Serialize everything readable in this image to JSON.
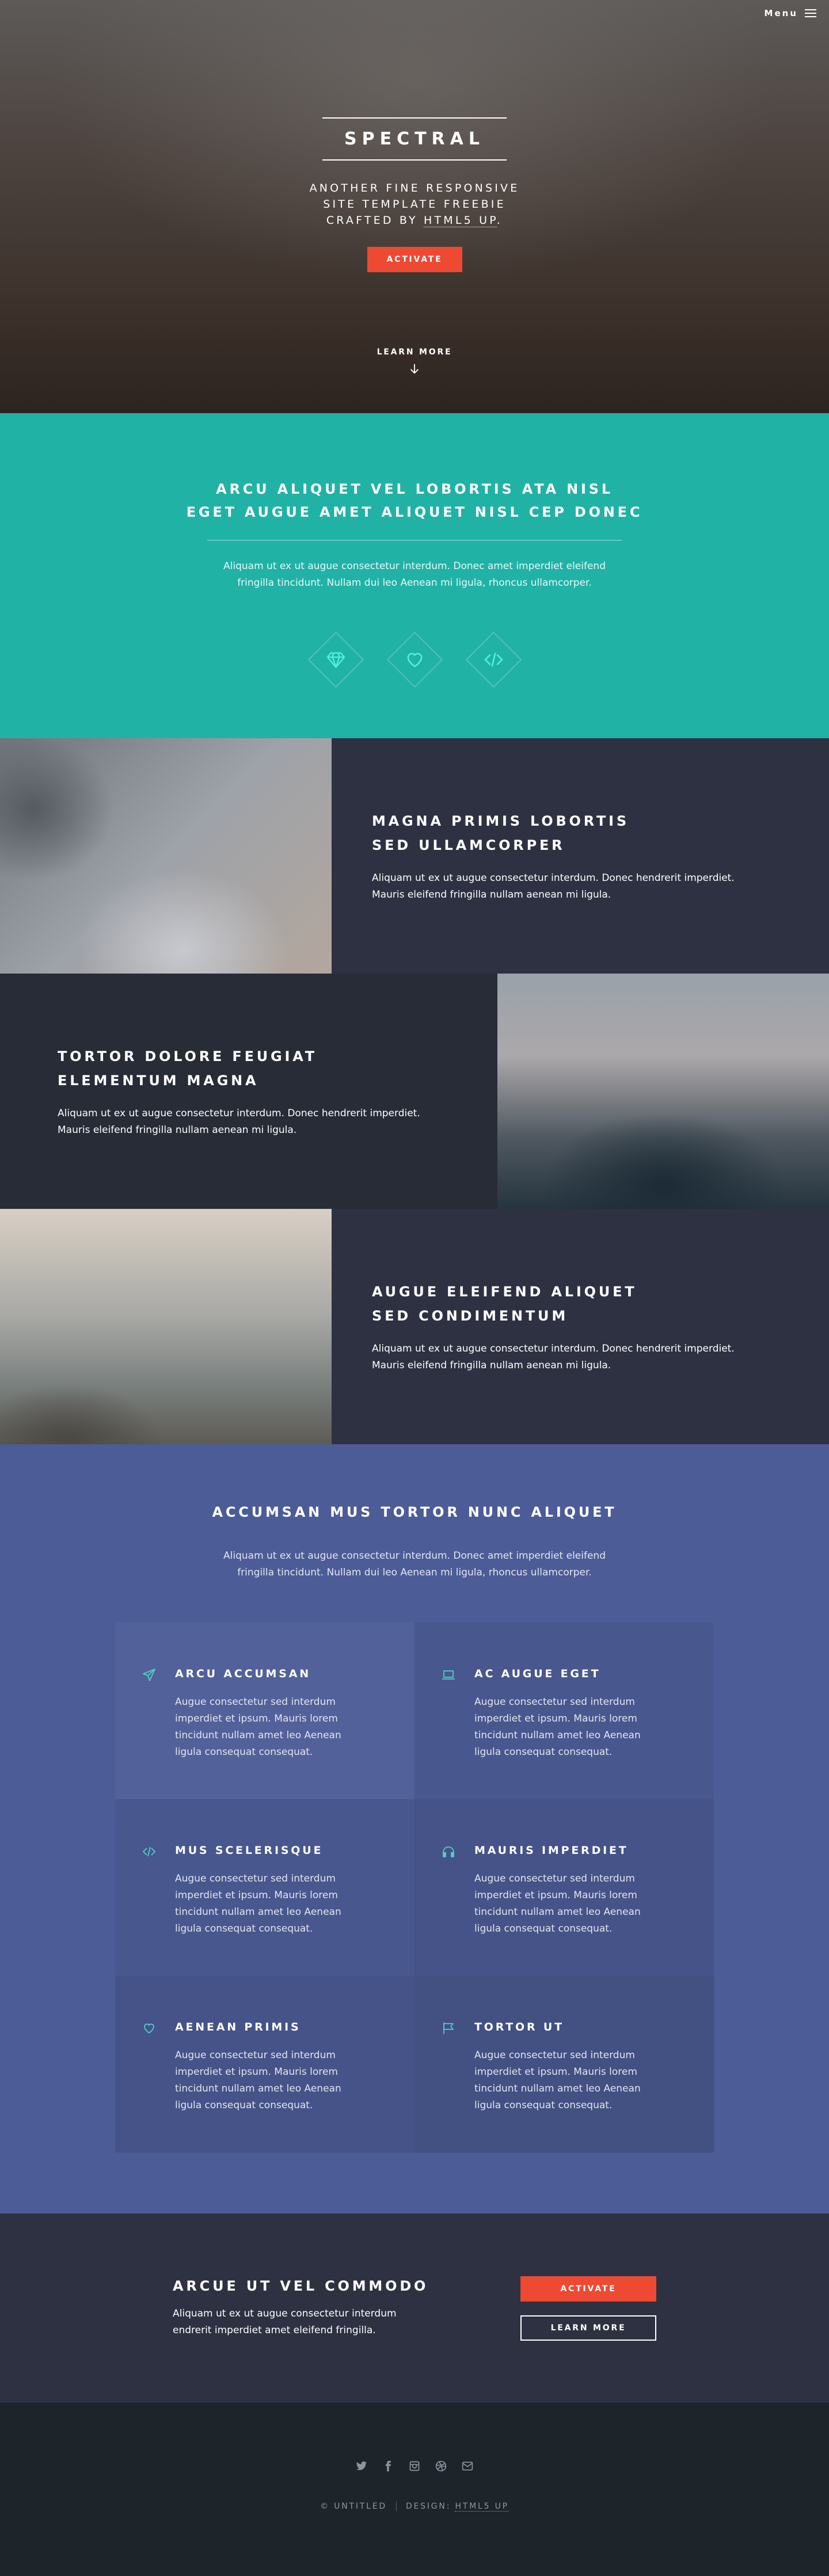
{
  "colors": {
    "accent": "#ed4933",
    "teal": "#21b2a6",
    "spotlight_dark": "#2e3141",
    "features_bg": "#4c5c96",
    "icon_teal": "#4fd0c5",
    "footer_bg": "#1d242a"
  },
  "header": {
    "menu_label": "Menu",
    "menu_icon": "hamburger-icon"
  },
  "hero": {
    "title": "Spectral",
    "subtitle_line1": "Another fine responsive",
    "subtitle_line2": "site template freebie",
    "subtitle_line3_prefix": "crafted by ",
    "subtitle_link": "HTML5 UP",
    "subtitle_line3_suffix": ".",
    "button": "Activate",
    "learn_more": "Learn More",
    "learn_more_icon": "arrow-down-icon"
  },
  "banner": {
    "title_line1": "Arcu aliquet vel lobortis ata nisl",
    "title_line2": "eget augue amet aliquet nisl cep donec",
    "text_line1": "Aliquam ut ex ut augue consectetur interdum. Donec amet imperdiet eleifend",
    "text_line2": "fringilla tincidunt. Nullam dui leo Aenean mi ligula, rhoncus ullamcorper.",
    "icons": [
      "diamond-icon",
      "heart-icon",
      "code-icon"
    ]
  },
  "spotlights": [
    {
      "title_line1": "Magna primis lobortis",
      "title_line2": "sed ullamcorper",
      "text_line1": "Aliquam ut ex ut augue consectetur interdum. Donec hendrerit imperdiet.",
      "text_line2": "Mauris eleifend fringilla nullam aenean mi ligula."
    },
    {
      "title_line1": "Tortor dolore feugiat",
      "title_line2": "elementum magna",
      "text_line1": "Aliquam ut ex ut augue consectetur interdum. Donec hendrerit imperdiet.",
      "text_line2": "Mauris eleifend fringilla nullam aenean mi ligula."
    },
    {
      "title_line1": "Augue eleifend aliquet",
      "title_line2": "sed condimentum",
      "text_line1": "Aliquam ut ex ut augue consectetur interdum. Donec hendrerit imperdiet.",
      "text_line2": "Mauris eleifend fringilla nullam aenean mi ligula."
    }
  ],
  "features": {
    "title": "Accumsan mus tortor nunc aliquet",
    "intro_line1": "Aliquam ut ex ut augue consectetur interdum. Donec amet imperdiet eleifend",
    "intro_line2": "fringilla tincidunt. Nullam dui leo Aenean mi ligula, rhoncus ullamcorper.",
    "items": [
      {
        "title": "Arcu Accumsan",
        "icon": "paper-plane-icon",
        "l1": "Augue consectetur sed interdum",
        "l2": "imperdiet et ipsum. Mauris lorem",
        "l3": "tincidunt nullam amet leo Aenean",
        "l4": "ligula consequat consequat."
      },
      {
        "title": "Ac Augue Eget",
        "icon": "laptop-icon",
        "l1": "Augue consectetur sed interdum",
        "l2": "imperdiet et ipsum. Mauris lorem",
        "l3": "tincidunt nullam amet leo Aenean",
        "l4": "ligula consequat consequat."
      },
      {
        "title": "Mus Scelerisque",
        "icon": "code-icon",
        "l1": "Augue consectetur sed interdum",
        "l2": "imperdiet et ipsum. Mauris lorem",
        "l3": "tincidunt nullam amet leo Aenean",
        "l4": "ligula consequat consequat."
      },
      {
        "title": "Mauris Imperdiet",
        "icon": "headphones-icon",
        "l1": "Augue consectetur sed interdum",
        "l2": "imperdiet et ipsum. Mauris lorem",
        "l3": "tincidunt nullam amet leo Aenean",
        "l4": "ligula consequat consequat."
      },
      {
        "title": "Aenean Primis",
        "icon": "heart-icon",
        "l1": "Augue consectetur sed interdum",
        "l2": "imperdiet et ipsum. Mauris lorem",
        "l3": "tincidunt nullam amet leo Aenean",
        "l4": "ligula consequat consequat."
      },
      {
        "title": "Tortor Ut",
        "icon": "flag-icon",
        "l1": "Augue consectetur sed interdum",
        "l2": "imperdiet et ipsum. Mauris lorem",
        "l3": "tincidunt nullam amet leo Aenean",
        "l4": "ligula consequat consequat."
      }
    ]
  },
  "cta": {
    "title": "Arcue ut vel commodo",
    "text_line1": "Aliquam ut ex ut augue consectetur interdum",
    "text_line2": "endrerit imperdiet amet eleifend fringilla.",
    "primary": "Activate",
    "secondary": "Learn More"
  },
  "footer": {
    "socials": [
      "twitter-icon",
      "facebook-icon",
      "instagram-icon",
      "dribbble-icon",
      "email-icon"
    ],
    "copyright": "© Untitled",
    "design_prefix": "Design: ",
    "design_link": "HTML5 UP"
  }
}
